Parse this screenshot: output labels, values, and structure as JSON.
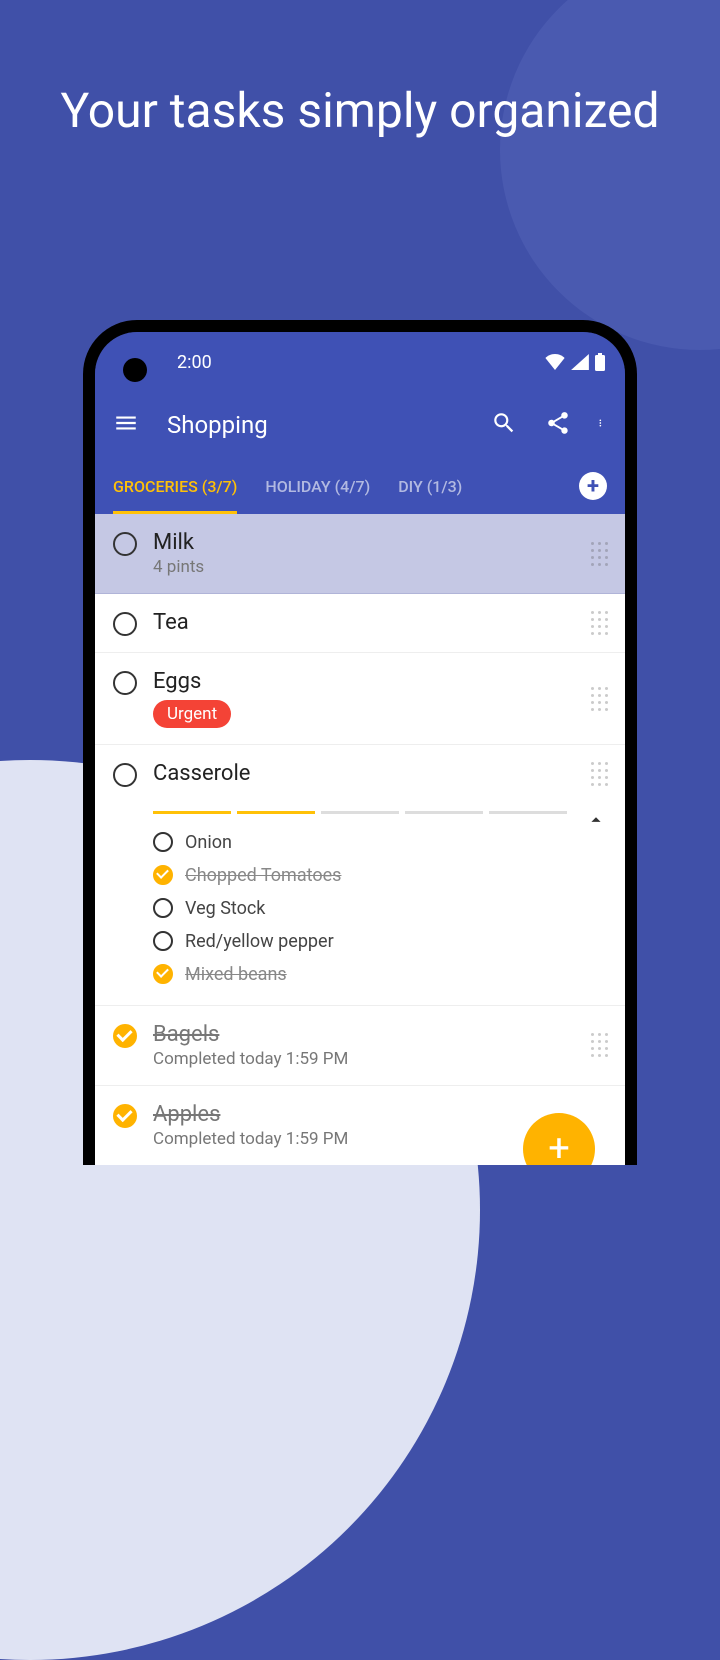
{
  "promo": {
    "title": "Your tasks simply organized"
  },
  "status": {
    "time": "2:00"
  },
  "appbar": {
    "title": "Shopping"
  },
  "tabs": [
    {
      "label": "GROCERIES (3/7)",
      "active": true
    },
    {
      "label": "HOLIDAY (4/7)",
      "active": false
    },
    {
      "label": "DIY (1/3)",
      "active": false
    }
  ],
  "items": [
    {
      "title": "Milk",
      "sub": "4 pints",
      "done": false,
      "tint": true
    },
    {
      "title": "Tea",
      "done": false
    },
    {
      "title": "Eggs",
      "tag": "Urgent",
      "done": false
    },
    {
      "title": "Casserole",
      "done": false,
      "progress": [
        true,
        true,
        false,
        false,
        false
      ],
      "subs": [
        {
          "title": "Onion",
          "done": false
        },
        {
          "title": "Chopped Tomatoes",
          "done": true
        },
        {
          "title": "Veg Stock",
          "done": false
        },
        {
          "title": "Red/yellow pepper",
          "done": false
        },
        {
          "title": "Mixed beans",
          "done": true
        }
      ]
    },
    {
      "title": "Bagels",
      "sub": "Completed today 1:59 PM",
      "done": true
    },
    {
      "title": "Apples",
      "sub": "Completed today 1:59 PM",
      "done": true
    }
  ]
}
